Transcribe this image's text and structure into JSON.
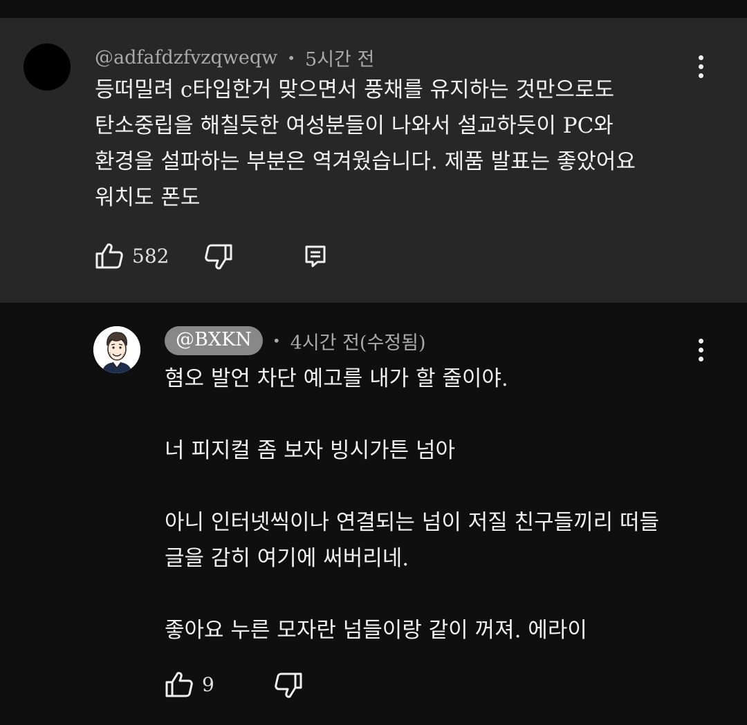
{
  "comments": [
    {
      "handle": "@adfafdzfvzqweqw",
      "separator": "•",
      "time": "5시간 전",
      "text": "등떠밀려 c타입한거 맞으면서 풍채를 유지하는 것만으로도\n탄소중립을 해칠듯한 여성분들이 나와서 설교하듯이 PC와\n환경을 설파하는 부분은 역겨웠습니다. 제품 발표는 좋았어요\n워치도 폰도",
      "likes": "582",
      "icons": [
        "thumbs-up-icon",
        "thumbs-down-icon",
        "reply-icon",
        "more-vert-icon"
      ]
    },
    {
      "handle": "@BXKN",
      "separator": "•",
      "time": "4시간 전(수정됨)",
      "text": "혐오 발언 차단 예고를 내가 할 줄이야.\n\n너 피지컬 좀 보자 빙시가튼 넘아\n\n아니 인터넷씩이나 연결되는 넘이 저질 친구들끼리 떠들\n글을 감히 여기에 써버리네.\n\n좋아요 누른 모자란 넘들이랑 같이 꺼져. 에라이",
      "likes": "9",
      "icons": [
        "thumbs-up-icon",
        "thumbs-down-icon",
        "more-vert-icon"
      ]
    }
  ],
  "colors": {
    "background": "#0f0f0f",
    "highlighted_comment_bg": "#272727",
    "secondary_text": "#aaaaaa",
    "handle_pill": "#888888"
  }
}
